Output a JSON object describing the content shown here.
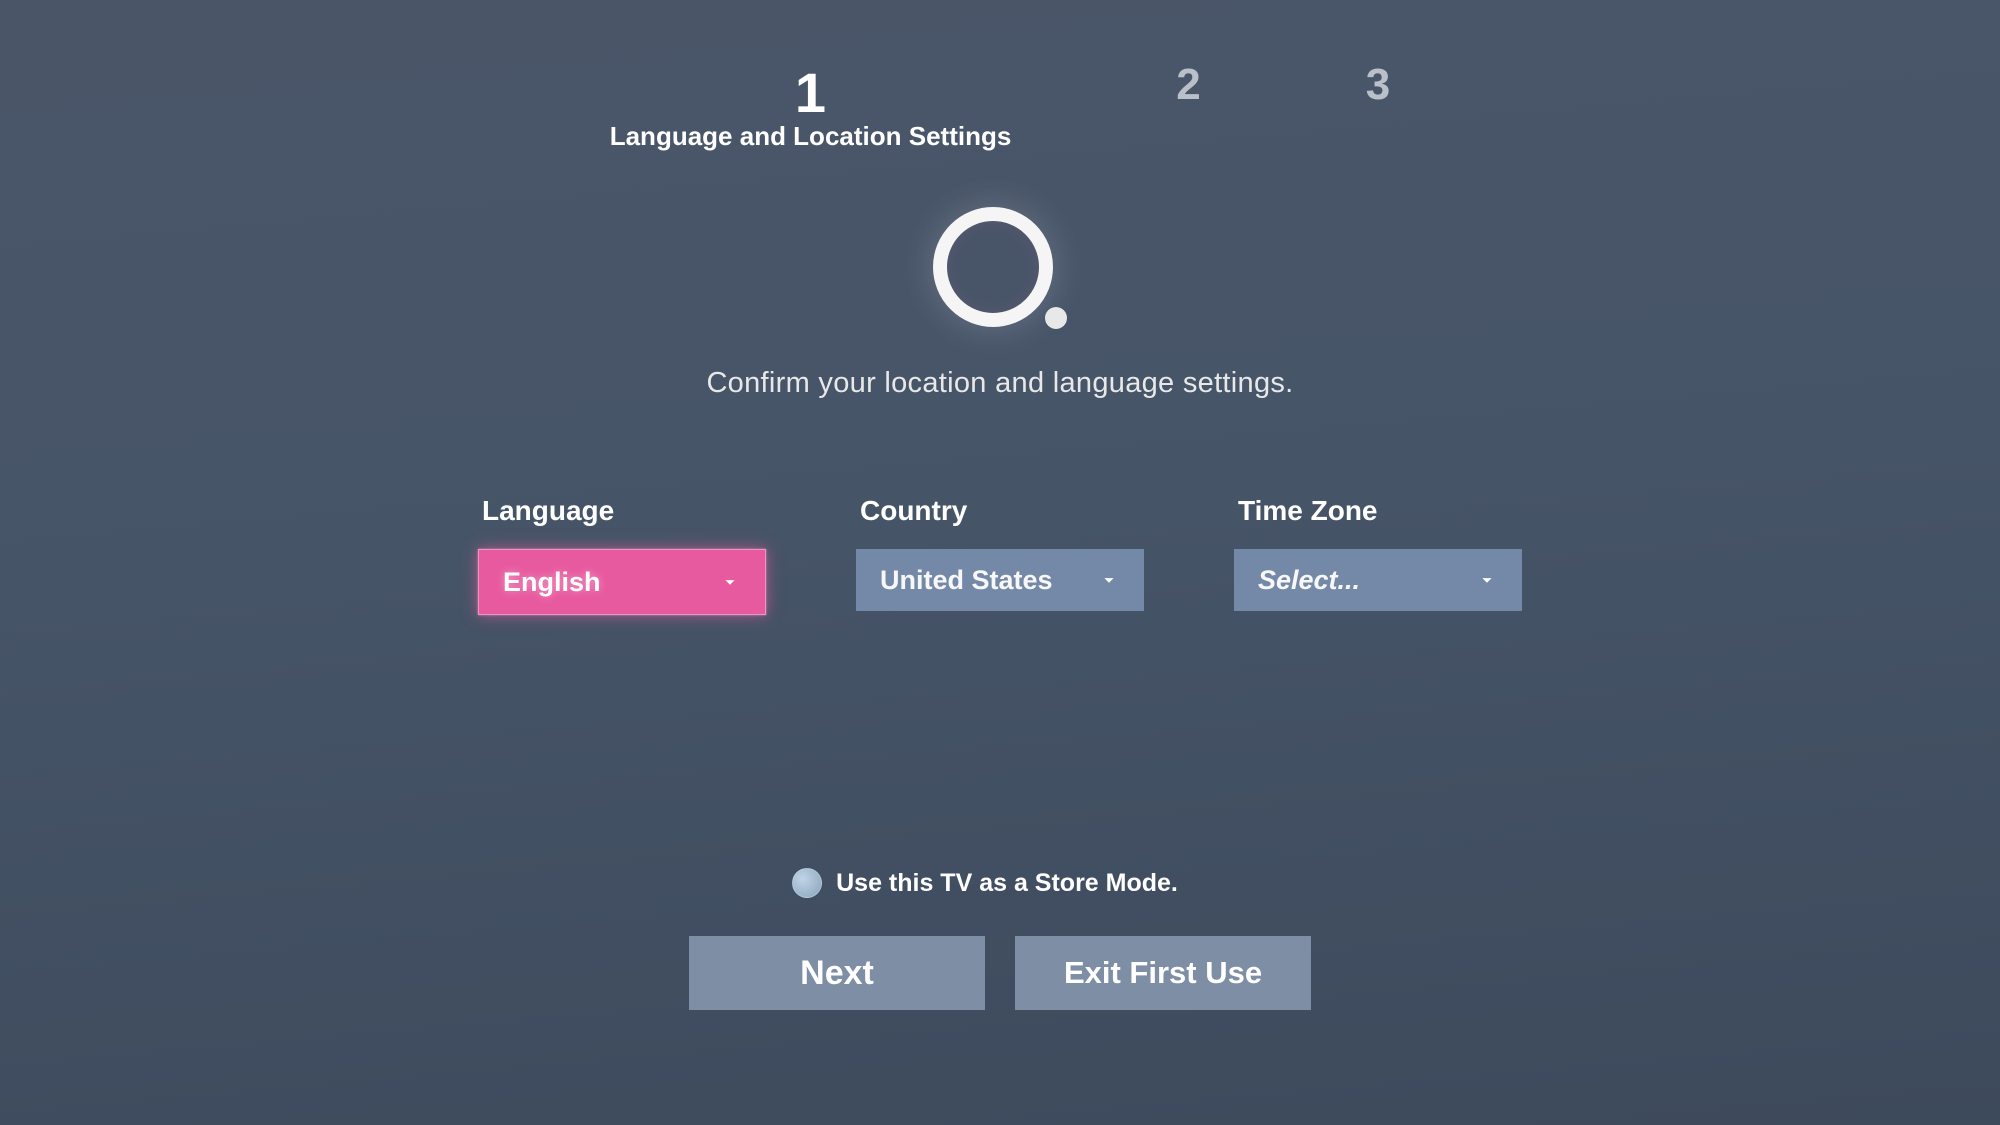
{
  "steps": {
    "items": [
      {
        "number": "1",
        "label": "Language and Location Settings"
      },
      {
        "number": "2",
        "label": ""
      },
      {
        "number": "3",
        "label": ""
      }
    ],
    "active_index": 0
  },
  "subtitle": "Confirm your location and language settings.",
  "form": {
    "language": {
      "label": "Language",
      "value": "English"
    },
    "country": {
      "label": "Country",
      "value": "United States"
    },
    "timezone": {
      "label": "Time Zone",
      "value": "Select..."
    }
  },
  "store_mode_label": "Use this TV as a Store Mode.",
  "buttons": {
    "next": "Next",
    "exit": "Exit First Use"
  }
}
